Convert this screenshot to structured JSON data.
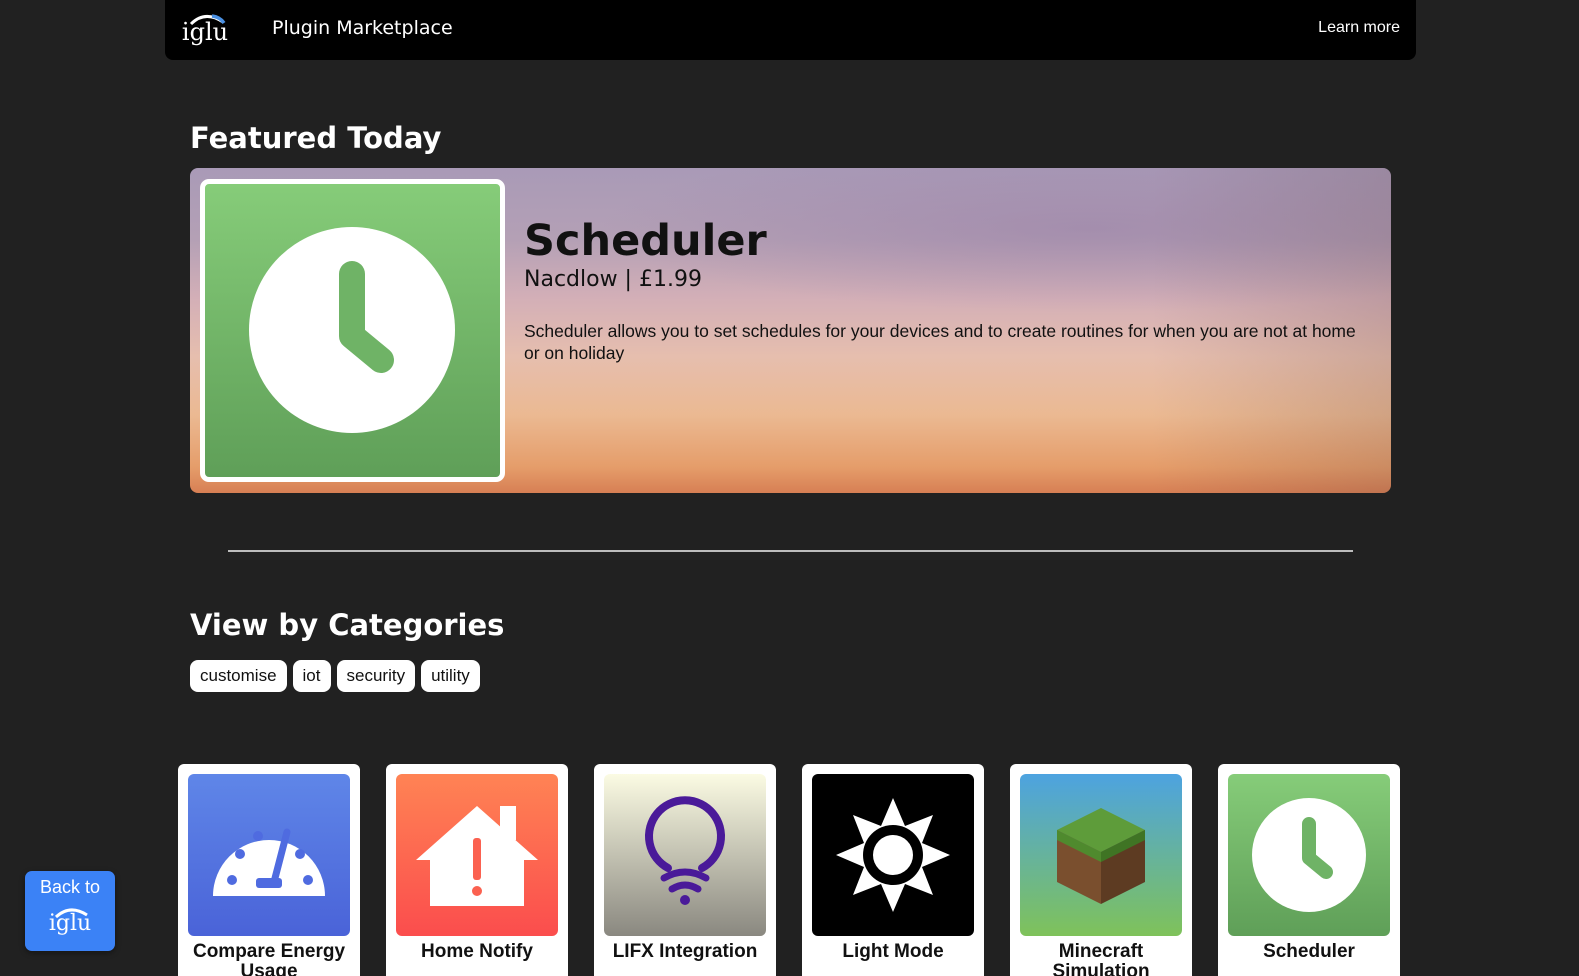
{
  "header": {
    "logo_text": "iglu",
    "title": "Plugin Marketplace",
    "learn_more": "Learn more"
  },
  "featured": {
    "heading": "Featured Today",
    "name": "Scheduler",
    "meta": "Nacdlow | £1.99",
    "description": "Scheduler allows you to set schedules for your devices and to create routines for when you are not at home or on holiday",
    "icon": "clock-icon"
  },
  "categories": {
    "heading": "View by Categories",
    "items": [
      "customise",
      "iot",
      "security",
      "utility"
    ]
  },
  "plugins": [
    {
      "name": "Compare Energy Usage",
      "icon": "gauge-icon"
    },
    {
      "name": "Home Notify",
      "icon": "house-alert-icon"
    },
    {
      "name": "LIFX Integration",
      "icon": "bulb-wifi-icon"
    },
    {
      "name": "Light Mode",
      "icon": "sun-icon"
    },
    {
      "name": "Minecraft Simulation",
      "icon": "grass-block-icon"
    },
    {
      "name": "Scheduler",
      "icon": "clock-icon"
    }
  ],
  "back_button": {
    "label": "Back to",
    "logo_text": "iglu"
  },
  "colors": {
    "background": "#212121",
    "accent_blue": "#3b82f6",
    "scheduler_green": "#6fb366"
  }
}
